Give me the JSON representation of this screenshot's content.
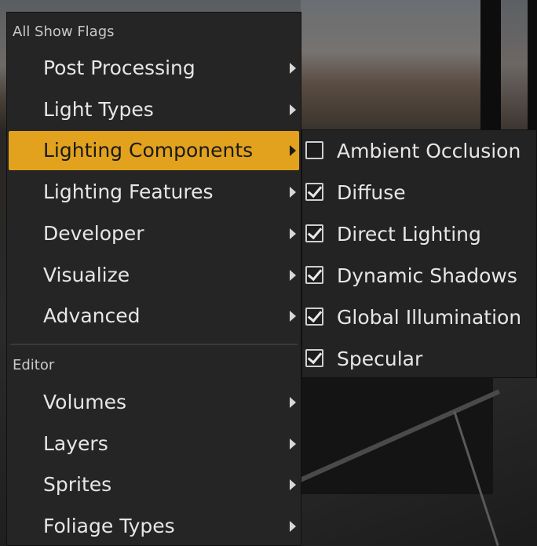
{
  "menu": {
    "sections": [
      {
        "header": "All Show Flags",
        "items": [
          {
            "label": "Post Processing",
            "has_submenu": true
          },
          {
            "label": "Light Types",
            "has_submenu": true
          },
          {
            "label": "Lighting Components",
            "has_submenu": true,
            "active": true
          },
          {
            "label": "Lighting Features",
            "has_submenu": true
          },
          {
            "label": "Developer",
            "has_submenu": true
          },
          {
            "label": "Visualize",
            "has_submenu": true
          },
          {
            "label": "Advanced",
            "has_submenu": true
          }
        ]
      },
      {
        "header": "Editor",
        "items": [
          {
            "label": "Volumes",
            "has_submenu": true
          },
          {
            "label": "Layers",
            "has_submenu": true
          },
          {
            "label": "Sprites",
            "has_submenu": true
          },
          {
            "label": "Foliage Types",
            "has_submenu": true
          }
        ]
      }
    ]
  },
  "submenu": {
    "items": [
      {
        "label": "Ambient Occlusion",
        "checked": false
      },
      {
        "label": "Diffuse",
        "checked": true
      },
      {
        "label": "Direct Lighting",
        "checked": true
      },
      {
        "label": "Dynamic Shadows",
        "checked": true
      },
      {
        "label": "Global Illumination",
        "checked": true
      },
      {
        "label": "Specular",
        "checked": true
      }
    ]
  },
  "colors": {
    "highlight": "#e2a21e",
    "menu_bg": "#252525",
    "text": "#e6e6e6"
  }
}
